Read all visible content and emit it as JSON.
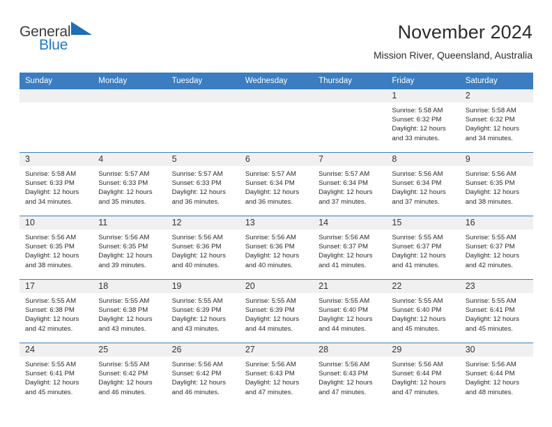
{
  "brand": {
    "name_part1": "General",
    "name_part2": "Blue",
    "triangle_icon": "triangle-right-icon",
    "color_dark": "#3b3b3b",
    "color_blue": "#1e7bc4"
  },
  "header": {
    "title": "November 2024",
    "subtitle": "Mission River, Queensland, Australia"
  },
  "theme": {
    "header_bg": "#3b7dc0",
    "header_text": "#ffffff",
    "daynum_bg": "#f0f0f0",
    "row_divider": "#3b7dc0",
    "body_text": "#2a2a2a"
  },
  "weekday_headers": [
    "Sunday",
    "Monday",
    "Tuesday",
    "Wednesday",
    "Thursday",
    "Friday",
    "Saturday"
  ],
  "labels": {
    "sunrise_prefix": "Sunrise:",
    "sunset_prefix": "Sunset:",
    "daylight_prefix": "Daylight:"
  },
  "weeks": [
    [
      {
        "day": "",
        "blank": true,
        "sunrise": "",
        "sunset": "",
        "daylight_line1": "",
        "daylight_line2": ""
      },
      {
        "day": "",
        "blank": true,
        "sunrise": "",
        "sunset": "",
        "daylight_line1": "",
        "daylight_line2": ""
      },
      {
        "day": "",
        "blank": true,
        "sunrise": "",
        "sunset": "",
        "daylight_line1": "",
        "daylight_line2": ""
      },
      {
        "day": "",
        "blank": true,
        "sunrise": "",
        "sunset": "",
        "daylight_line1": "",
        "daylight_line2": ""
      },
      {
        "day": "",
        "blank": true,
        "sunrise": "",
        "sunset": "",
        "daylight_line1": "",
        "daylight_line2": ""
      },
      {
        "day": "1",
        "blank": false,
        "sunrise": "Sunrise: 5:58 AM",
        "sunset": "Sunset: 6:32 PM",
        "daylight_line1": "Daylight: 12 hours",
        "daylight_line2": "and 33 minutes."
      },
      {
        "day": "2",
        "blank": false,
        "sunrise": "Sunrise: 5:58 AM",
        "sunset": "Sunset: 6:32 PM",
        "daylight_line1": "Daylight: 12 hours",
        "daylight_line2": "and 34 minutes."
      }
    ],
    [
      {
        "day": "3",
        "blank": false,
        "sunrise": "Sunrise: 5:58 AM",
        "sunset": "Sunset: 6:33 PM",
        "daylight_line1": "Daylight: 12 hours",
        "daylight_line2": "and 34 minutes."
      },
      {
        "day": "4",
        "blank": false,
        "sunrise": "Sunrise: 5:57 AM",
        "sunset": "Sunset: 6:33 PM",
        "daylight_line1": "Daylight: 12 hours",
        "daylight_line2": "and 35 minutes."
      },
      {
        "day": "5",
        "blank": false,
        "sunrise": "Sunrise: 5:57 AM",
        "sunset": "Sunset: 6:33 PM",
        "daylight_line1": "Daylight: 12 hours",
        "daylight_line2": "and 36 minutes."
      },
      {
        "day": "6",
        "blank": false,
        "sunrise": "Sunrise: 5:57 AM",
        "sunset": "Sunset: 6:34 PM",
        "daylight_line1": "Daylight: 12 hours",
        "daylight_line2": "and 36 minutes."
      },
      {
        "day": "7",
        "blank": false,
        "sunrise": "Sunrise: 5:57 AM",
        "sunset": "Sunset: 6:34 PM",
        "daylight_line1": "Daylight: 12 hours",
        "daylight_line2": "and 37 minutes."
      },
      {
        "day": "8",
        "blank": false,
        "sunrise": "Sunrise: 5:56 AM",
        "sunset": "Sunset: 6:34 PM",
        "daylight_line1": "Daylight: 12 hours",
        "daylight_line2": "and 37 minutes."
      },
      {
        "day": "9",
        "blank": false,
        "sunrise": "Sunrise: 5:56 AM",
        "sunset": "Sunset: 6:35 PM",
        "daylight_line1": "Daylight: 12 hours",
        "daylight_line2": "and 38 minutes."
      }
    ],
    [
      {
        "day": "10",
        "blank": false,
        "sunrise": "Sunrise: 5:56 AM",
        "sunset": "Sunset: 6:35 PM",
        "daylight_line1": "Daylight: 12 hours",
        "daylight_line2": "and 38 minutes."
      },
      {
        "day": "11",
        "blank": false,
        "sunrise": "Sunrise: 5:56 AM",
        "sunset": "Sunset: 6:35 PM",
        "daylight_line1": "Daylight: 12 hours",
        "daylight_line2": "and 39 minutes."
      },
      {
        "day": "12",
        "blank": false,
        "sunrise": "Sunrise: 5:56 AM",
        "sunset": "Sunset: 6:36 PM",
        "daylight_line1": "Daylight: 12 hours",
        "daylight_line2": "and 40 minutes."
      },
      {
        "day": "13",
        "blank": false,
        "sunrise": "Sunrise: 5:56 AM",
        "sunset": "Sunset: 6:36 PM",
        "daylight_line1": "Daylight: 12 hours",
        "daylight_line2": "and 40 minutes."
      },
      {
        "day": "14",
        "blank": false,
        "sunrise": "Sunrise: 5:56 AM",
        "sunset": "Sunset: 6:37 PM",
        "daylight_line1": "Daylight: 12 hours",
        "daylight_line2": "and 41 minutes."
      },
      {
        "day": "15",
        "blank": false,
        "sunrise": "Sunrise: 5:55 AM",
        "sunset": "Sunset: 6:37 PM",
        "daylight_line1": "Daylight: 12 hours",
        "daylight_line2": "and 41 minutes."
      },
      {
        "day": "16",
        "blank": false,
        "sunrise": "Sunrise: 5:55 AM",
        "sunset": "Sunset: 6:37 PM",
        "daylight_line1": "Daylight: 12 hours",
        "daylight_line2": "and 42 minutes."
      }
    ],
    [
      {
        "day": "17",
        "blank": false,
        "sunrise": "Sunrise: 5:55 AM",
        "sunset": "Sunset: 6:38 PM",
        "daylight_line1": "Daylight: 12 hours",
        "daylight_line2": "and 42 minutes."
      },
      {
        "day": "18",
        "blank": false,
        "sunrise": "Sunrise: 5:55 AM",
        "sunset": "Sunset: 6:38 PM",
        "daylight_line1": "Daylight: 12 hours",
        "daylight_line2": "and 43 minutes."
      },
      {
        "day": "19",
        "blank": false,
        "sunrise": "Sunrise: 5:55 AM",
        "sunset": "Sunset: 6:39 PM",
        "daylight_line1": "Daylight: 12 hours",
        "daylight_line2": "and 43 minutes."
      },
      {
        "day": "20",
        "blank": false,
        "sunrise": "Sunrise: 5:55 AM",
        "sunset": "Sunset: 6:39 PM",
        "daylight_line1": "Daylight: 12 hours",
        "daylight_line2": "and 44 minutes."
      },
      {
        "day": "21",
        "blank": false,
        "sunrise": "Sunrise: 5:55 AM",
        "sunset": "Sunset: 6:40 PM",
        "daylight_line1": "Daylight: 12 hours",
        "daylight_line2": "and 44 minutes."
      },
      {
        "day": "22",
        "blank": false,
        "sunrise": "Sunrise: 5:55 AM",
        "sunset": "Sunset: 6:40 PM",
        "daylight_line1": "Daylight: 12 hours",
        "daylight_line2": "and 45 minutes."
      },
      {
        "day": "23",
        "blank": false,
        "sunrise": "Sunrise: 5:55 AM",
        "sunset": "Sunset: 6:41 PM",
        "daylight_line1": "Daylight: 12 hours",
        "daylight_line2": "and 45 minutes."
      }
    ],
    [
      {
        "day": "24",
        "blank": false,
        "sunrise": "Sunrise: 5:55 AM",
        "sunset": "Sunset: 6:41 PM",
        "daylight_line1": "Daylight: 12 hours",
        "daylight_line2": "and 45 minutes."
      },
      {
        "day": "25",
        "blank": false,
        "sunrise": "Sunrise: 5:55 AM",
        "sunset": "Sunset: 6:42 PM",
        "daylight_line1": "Daylight: 12 hours",
        "daylight_line2": "and 46 minutes."
      },
      {
        "day": "26",
        "blank": false,
        "sunrise": "Sunrise: 5:56 AM",
        "sunset": "Sunset: 6:42 PM",
        "daylight_line1": "Daylight: 12 hours",
        "daylight_line2": "and 46 minutes."
      },
      {
        "day": "27",
        "blank": false,
        "sunrise": "Sunrise: 5:56 AM",
        "sunset": "Sunset: 6:43 PM",
        "daylight_line1": "Daylight: 12 hours",
        "daylight_line2": "and 47 minutes."
      },
      {
        "day": "28",
        "blank": false,
        "sunrise": "Sunrise: 5:56 AM",
        "sunset": "Sunset: 6:43 PM",
        "daylight_line1": "Daylight: 12 hours",
        "daylight_line2": "and 47 minutes."
      },
      {
        "day": "29",
        "blank": false,
        "sunrise": "Sunrise: 5:56 AM",
        "sunset": "Sunset: 6:44 PM",
        "daylight_line1": "Daylight: 12 hours",
        "daylight_line2": "and 47 minutes."
      },
      {
        "day": "30",
        "blank": false,
        "sunrise": "Sunrise: 5:56 AM",
        "sunset": "Sunset: 6:44 PM",
        "daylight_line1": "Daylight: 12 hours",
        "daylight_line2": "and 48 minutes."
      }
    ]
  ]
}
